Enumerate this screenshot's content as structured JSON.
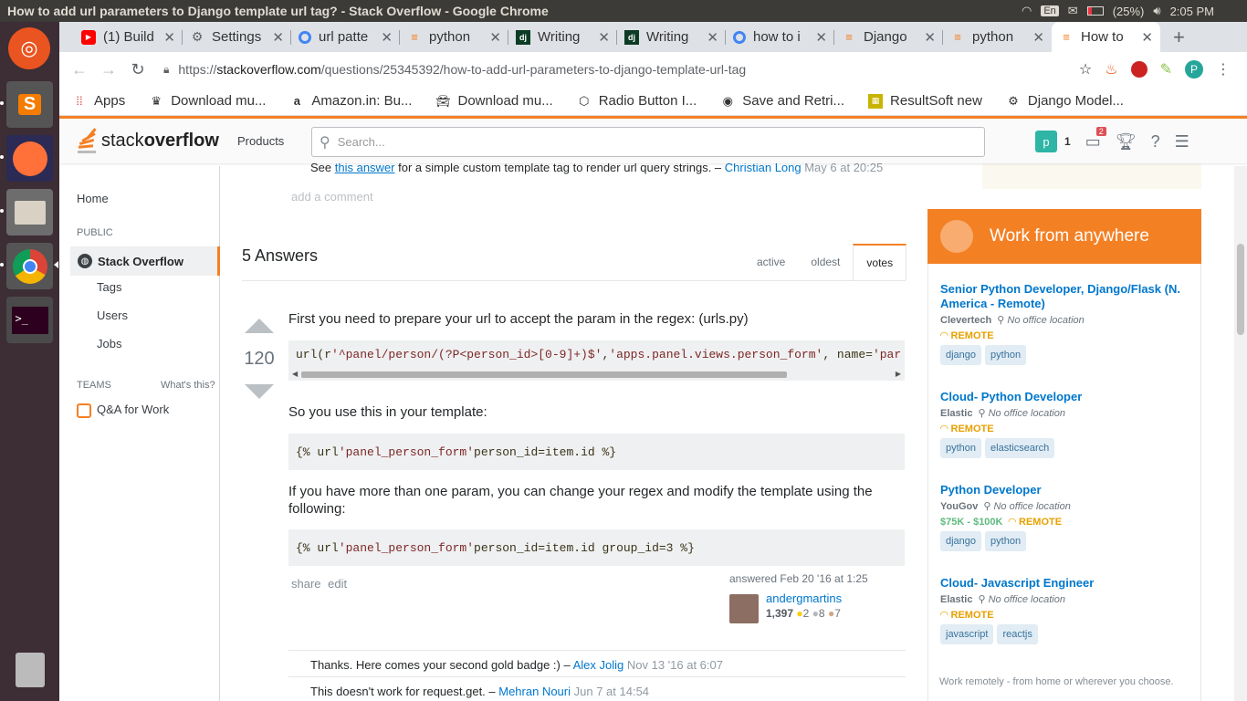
{
  "system": {
    "window_title": "How to add url parameters to Django template url tag? - Stack Overflow - Google Chrome",
    "lang": "En",
    "battery": "(25%)",
    "time": "2:05 PM"
  },
  "tabs": [
    {
      "label": "(1) Build",
      "icon": "youtube-icon"
    },
    {
      "label": "Settings",
      "icon": "settings-icon"
    },
    {
      "label": "url patte",
      "icon": "google-icon"
    },
    {
      "label": "python",
      "icon": "stackoverflow-icon"
    },
    {
      "label": "Writing",
      "icon": "django-icon"
    },
    {
      "label": "Writing",
      "icon": "django-icon"
    },
    {
      "label": "how to i",
      "icon": "google-icon"
    },
    {
      "label": "Django",
      "icon": "stackoverflow-icon"
    },
    {
      "label": "python",
      "icon": "stackoverflow-icon"
    },
    {
      "label": "How to",
      "icon": "stackoverflow-icon"
    }
  ],
  "address": {
    "scheme": "https://",
    "host": "stackoverflow.com",
    "path": "/questions/25345392/how-to-add-url-parameters-to-django-template-url-tag"
  },
  "extensions": {
    "abp_count": "3",
    "profile_letter": "P"
  },
  "bookmarks": [
    {
      "label": "Apps"
    },
    {
      "label": "Download mu..."
    },
    {
      "label": "Amazon.in: Bu..."
    },
    {
      "label": "Download mu..."
    },
    {
      "label": "Radio Button I..."
    },
    {
      "label": "Save and Retri..."
    },
    {
      "label": "ResultSoft new"
    },
    {
      "label": "Django Model..."
    }
  ],
  "so_header": {
    "logo_plain": "stack",
    "logo_bold": "overflow",
    "products": "Products",
    "search_placeholder": "Search...",
    "avatar_letter": "p",
    "reputation": "1",
    "inbox_badge": "2"
  },
  "leftnav": {
    "home": "Home",
    "public": "PUBLIC",
    "stack_overflow": "Stack Overflow",
    "tags": "Tags",
    "users": "Users",
    "jobs": "Jobs",
    "teams": "TEAMS",
    "whats_this": "What's this?",
    "qa_for_work": "Q&A for Work"
  },
  "question_comment": {
    "pre": "See ",
    "link": "this answer",
    "post": " for a simple custom template tag to render url query strings. – ",
    "user": "Christian Long",
    "date": " May 6 at 20:25"
  },
  "add_comment": "add a comment",
  "answers_header": "5 Answers",
  "sort_tabs": [
    "active",
    "oldest",
    "votes"
  ],
  "answer": {
    "votes": "120",
    "p1": "First you need to prepare your url to accept the param in the regex: (urls.py)",
    "code1_plain1": "url(r",
    "code1_str1": "'^panel/person/(?P<person_id>[0-9]+)$'",
    "code1_plain2": ", ",
    "code1_str2": "'apps.panel.views.person_form'",
    "code1_plain3": ", name=",
    "code1_str3": "'par",
    "p2": "So you use this in your template:",
    "code2_plain1": "{% url ",
    "code2_str1": "'panel_person_form'",
    "code2_plain2": " person_id=item.id %}",
    "p3": "If you have more than one param, you can change your regex and modify the template using the following:",
    "code3_plain1": "{% url ",
    "code3_str1": "'panel_person_form'",
    "code3_plain2": " person_id=item.id group_id=3 %}",
    "share": "share",
    "edit": "edit",
    "answered": "answered Feb 20 '16 at 1:25",
    "author": "andergmartins",
    "rep": "1,397",
    "gold": "2",
    "silver": "8",
    "bronze": "7"
  },
  "answer_comments": [
    {
      "text": "Thanks. Here comes your second gold badge :) – ",
      "user": "Alex Jolig",
      "date": " Nov 13 '16 at 6:07"
    },
    {
      "text": "This doesn't work for request.get. – ",
      "user": "Mehran Nouri",
      "date": " Jun 7 at 14:54"
    }
  ],
  "jobs": {
    "header": "Work from anywhere",
    "items": [
      {
        "title": "Senior Python Developer, Django/Flask (N. America - Remote)",
        "company": "Clevertech",
        "location": "No office location",
        "salary": "",
        "remote": "REMOTE",
        "tags": [
          "django",
          "python"
        ]
      },
      {
        "title": "Cloud- Python Developer",
        "company": "Elastic",
        "location": "No office location",
        "salary": "",
        "remote": "REMOTE",
        "tags": [
          "python",
          "elasticsearch"
        ]
      },
      {
        "title": "Python Developer",
        "company": "YouGov",
        "location": "No office location",
        "salary": "$75K - $100K",
        "remote": "REMOTE",
        "tags": [
          "django",
          "python"
        ]
      },
      {
        "title": "Cloud- Javascript Engineer",
        "company": "Elastic",
        "location": "No office location",
        "salary": "",
        "remote": "REMOTE",
        "tags": [
          "javascript",
          "reactjs"
        ]
      }
    ],
    "footer": "Work remotely - from home or wherever you choose."
  },
  "colors": {
    "so_orange": "#f48024",
    "link_blue": "#0077cc",
    "ubuntu_launcher": "#3d2d34"
  }
}
